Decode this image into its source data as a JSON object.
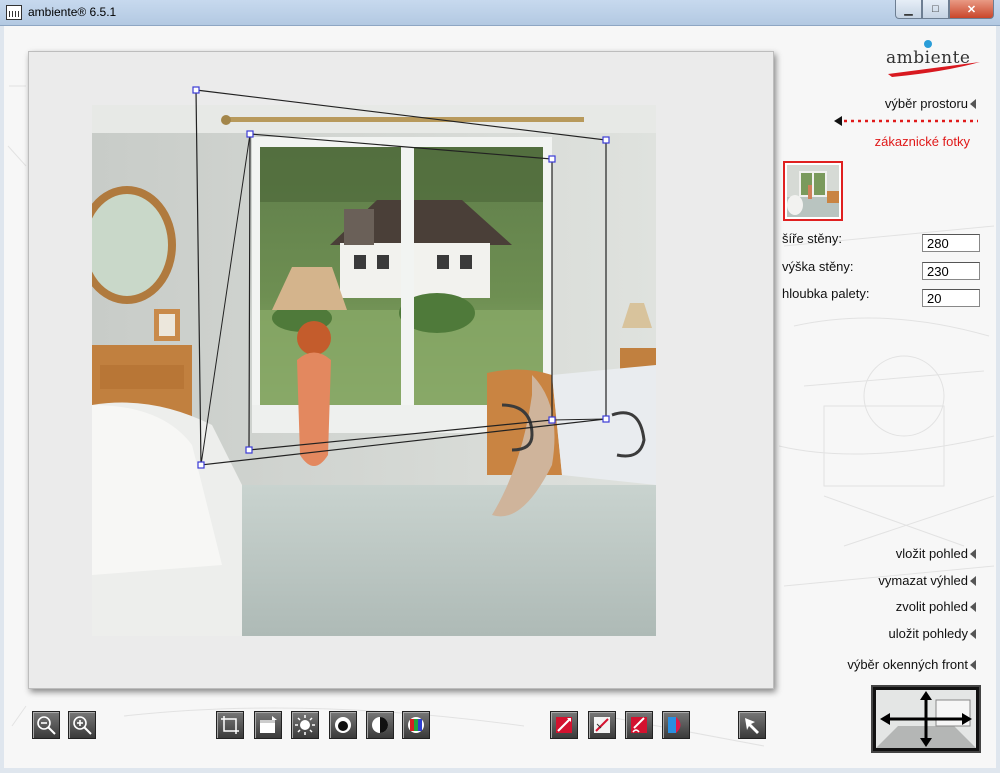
{
  "window": {
    "title": "ambiente® 6.5.1",
    "buttons": {
      "minimize": "▁",
      "maximize": "□",
      "close": "✕"
    }
  },
  "logo": {
    "text": "ambiente",
    "dot_color": "#2a9dd8",
    "swoosh_color": "#d81920"
  },
  "menu": {
    "room_select": "výběr prostoru",
    "customer_photos": "zákaznické fotky",
    "insert_view": "vložit pohled",
    "delete_view": "vymazat výhled",
    "choose_view": "zvolit pohled",
    "save_views": "uložit pohledy",
    "window_fronts": "výběr okenných front"
  },
  "fields": {
    "wall_width": {
      "label": "šíře stěny:",
      "value": "280"
    },
    "wall_height": {
      "label": "výška stěny:",
      "value": "230"
    },
    "pallet_depth": {
      "label": "hloubka palety:",
      "value": "20"
    }
  },
  "toolbar": {
    "icons": [
      "zoom-out-icon",
      "zoom-in-icon",
      "crop-icon",
      "open-file-icon",
      "brightness-icon",
      "exposure-icon",
      "contrast-icon",
      "color-balance-icon",
      "brush-red-icon",
      "brush-white-icon",
      "paint-red-icon",
      "color-fill-icon",
      "select-arrow-icon"
    ]
  },
  "colors": {
    "accent_red": "#e01a1a",
    "selection_handle": "#3b3bd6"
  }
}
